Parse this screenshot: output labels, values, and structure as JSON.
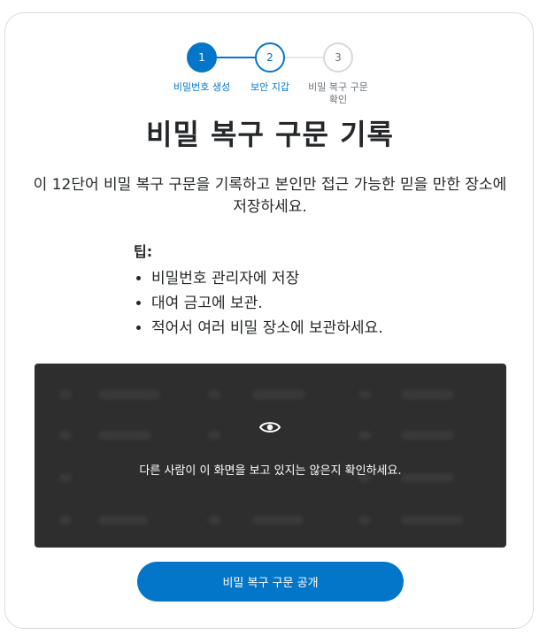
{
  "stepper": {
    "steps": [
      {
        "number": "1",
        "label": "비밀번호 생성"
      },
      {
        "number": "2",
        "label": "보안 지갑"
      },
      {
        "number": "3",
        "label": "비밀 복구 구문 확인"
      }
    ]
  },
  "title": "비밀 복구 구문 기록",
  "description": "이 12단어 비밀 복구 구문을 기록하고 본인만 접근 가능한 믿을 만한 장소에 저장하세요.",
  "tips": {
    "heading": "팁:",
    "items": [
      "비밀번호 관리자에 저장",
      "대여 금고에 보관.",
      "적어서 여러 비밀 장소에 보관하세요."
    ]
  },
  "secret_box": {
    "icon": "eye-icon",
    "warning": "다른 사람이 이 화면을 보고 있지는 않은지 확인하세요."
  },
  "reveal_button": {
    "label": "비밀 복구 구문 공개"
  },
  "colors": {
    "primary": "#0376c9",
    "overlay": "#2e2e2e",
    "text": "#24272a",
    "muted": "#6a737d"
  }
}
